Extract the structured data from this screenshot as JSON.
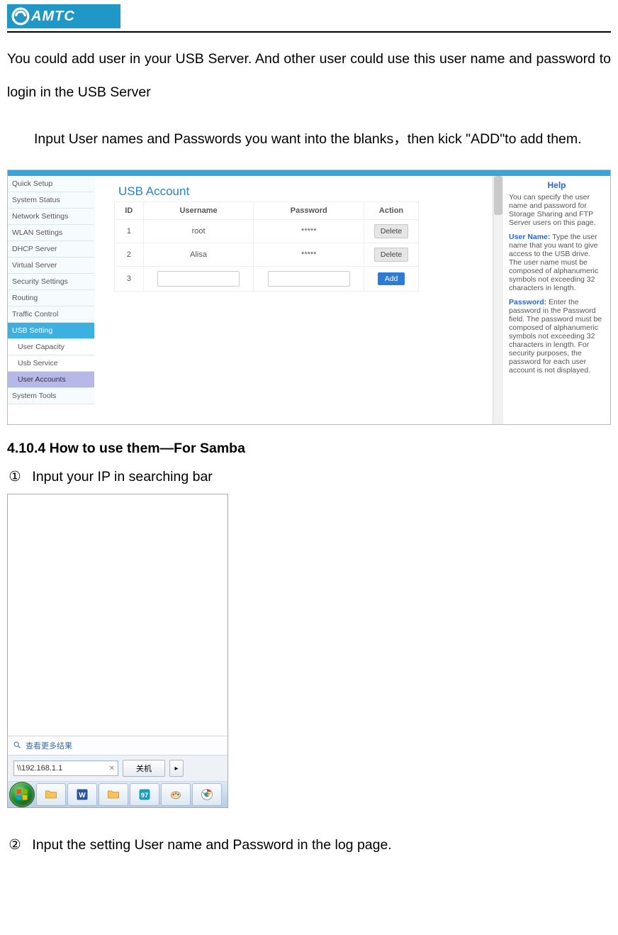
{
  "logo_text": "AMTC",
  "intro_p1": "You could add user in your USB Server. And other user could use this user name and password to login in the USB Server",
  "intro_p2": "Input User names and Passwords you want into the blanks，then kick \"ADD\"to add them.",
  "router": {
    "panel_title": "USB Account",
    "nav": [
      "Quick Setup",
      "System Status",
      "Network Settings",
      "WLAN Settings",
      "DHCP Server",
      "Virtual Server",
      "Security Settings",
      "Routing",
      "Traffic Control",
      "USB Setting",
      "User Capacity",
      "Usb Service",
      "User Accounts",
      "System Tools"
    ],
    "table": {
      "headers": [
        "ID",
        "Username",
        "Password",
        "Action"
      ],
      "rows": [
        {
          "id": "1",
          "user": "root",
          "pwd": "*****",
          "action": "Delete"
        },
        {
          "id": "2",
          "user": "Alisa",
          "pwd": "*****",
          "action": "Delete"
        }
      ],
      "new_id": "3",
      "add_label": "Add"
    },
    "help": {
      "title": "Help",
      "p1": "You can specify the user name and password for Storage Sharing and FTP Server users on this page.",
      "u_label": "User Name:",
      "u_text": " Type the user name that you want to give access to the USB drive. The user name must be composed of alphanumeric symbols not exceeding 32 characters in length.",
      "p_label": "Password:",
      "p_text": " Enter the password in the Password field. The password must be composed of alphanumeric symbols not exceeding 32 characters in length. For security purposes, the password for each user account is not displayed."
    }
  },
  "section_heading": "4.10.4 How to use them—For Samba",
  "step1": {
    "num": "①",
    "text": "Input your IP in searching bar"
  },
  "win": {
    "more": "查看更多结果",
    "search_value": "\\\\192.168.1.1",
    "shutdown_label": "关机",
    "arrow": "▸"
  },
  "step2": {
    "num": "②",
    "text": "Input the setting User name and Password in the log page."
  }
}
